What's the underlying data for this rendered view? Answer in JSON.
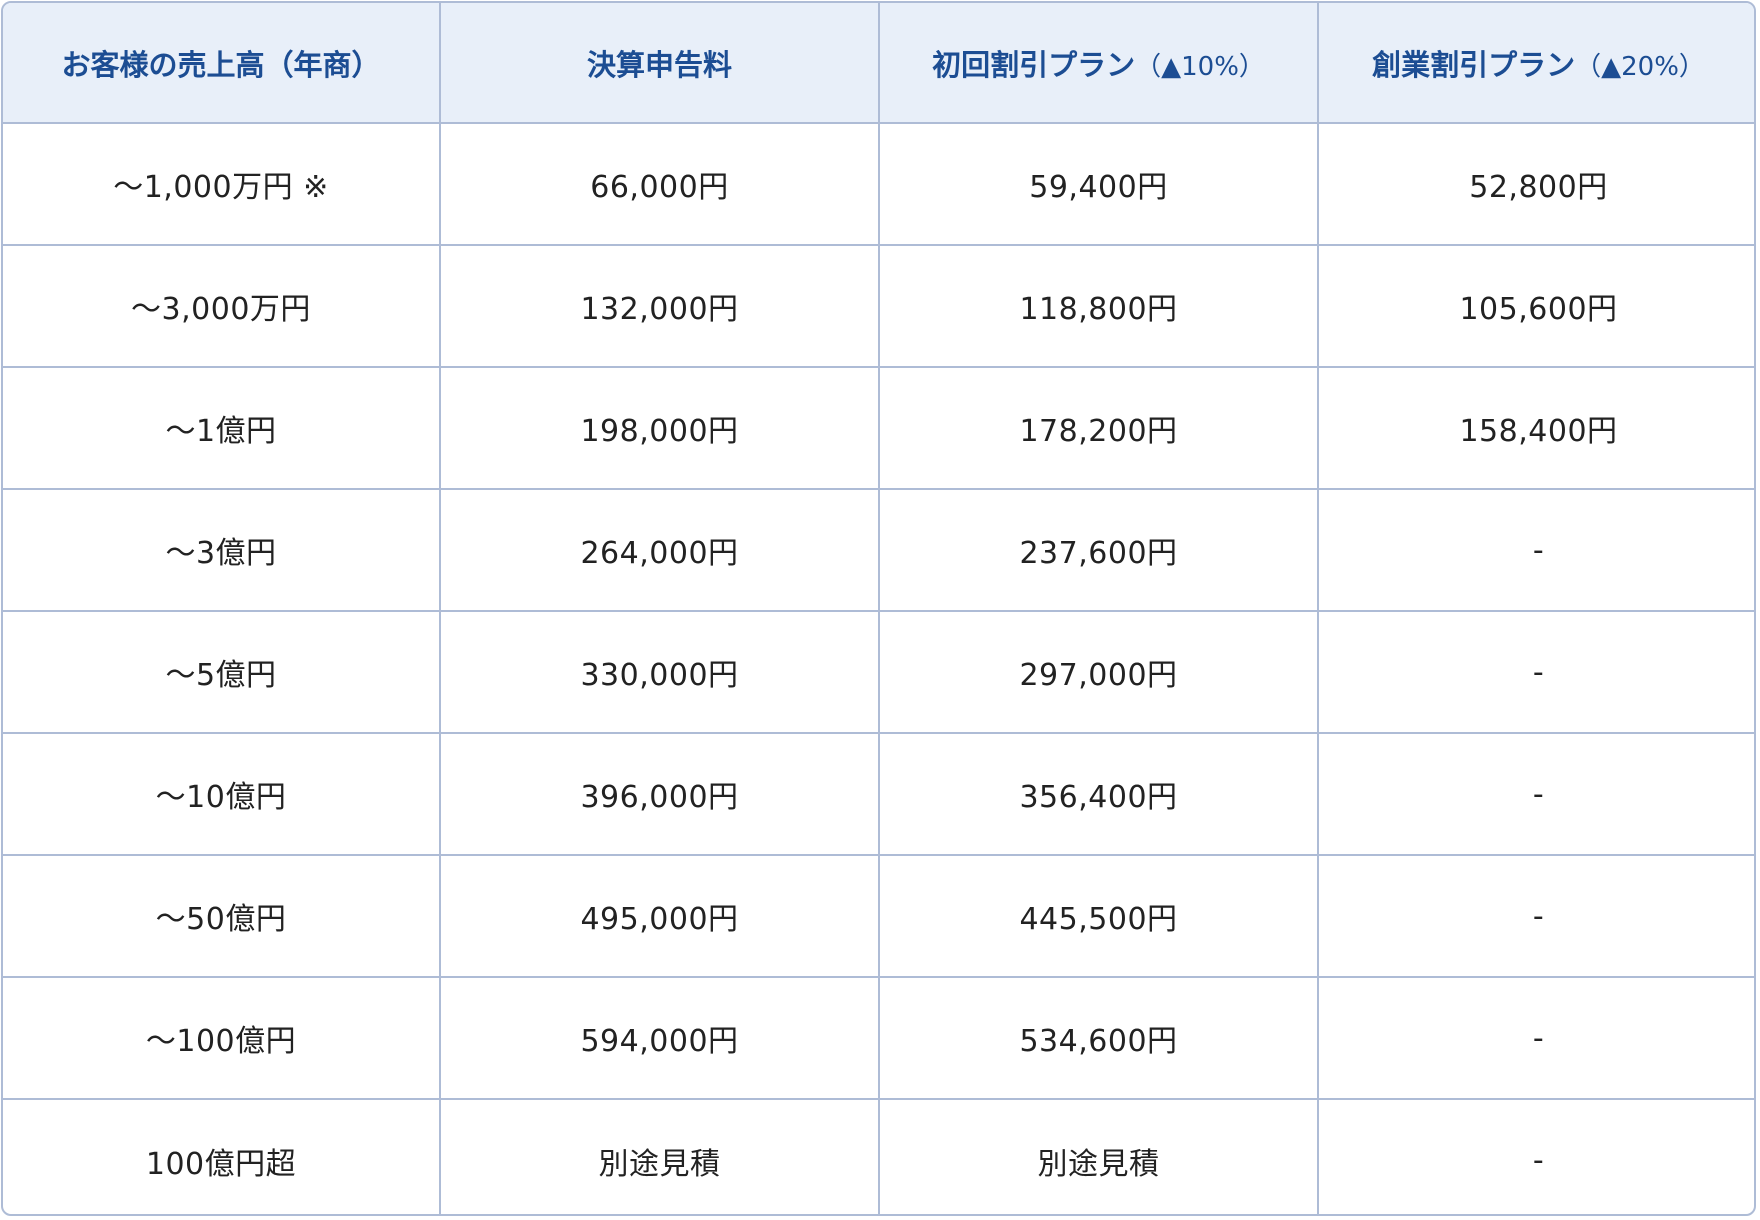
{
  "table": {
    "headers": [
      {
        "label": "お客様の売上高（年商）",
        "suffix": ""
      },
      {
        "label": "決算申告料",
        "suffix": ""
      },
      {
        "label": "初回割引プラン",
        "suffix": "（▲10%）"
      },
      {
        "label": "創業割引プラン",
        "suffix": "（▲20%）"
      }
    ],
    "rows": [
      {
        "revenue": "～1,000万円 ※",
        "fee": "66,000円",
        "first_discount": "59,400円",
        "startup_discount": "52,800円"
      },
      {
        "revenue": "～3,000万円",
        "fee": "132,000円",
        "first_discount": "118,800円",
        "startup_discount": "105,600円"
      },
      {
        "revenue": "～1億円",
        "fee": "198,000円",
        "first_discount": "178,200円",
        "startup_discount": "158,400円"
      },
      {
        "revenue": "～3億円",
        "fee": "264,000円",
        "first_discount": "237,600円",
        "startup_discount": "-"
      },
      {
        "revenue": "～5億円",
        "fee": "330,000円",
        "first_discount": "297,000円",
        "startup_discount": "-"
      },
      {
        "revenue": "～10億円",
        "fee": "396,000円",
        "first_discount": "356,400円",
        "startup_discount": "-"
      },
      {
        "revenue": "～50億円",
        "fee": "495,000円",
        "first_discount": "445,500円",
        "startup_discount": "-"
      },
      {
        "revenue": "～100億円",
        "fee": "594,000円",
        "first_discount": "534,600円",
        "startup_discount": "-"
      },
      {
        "revenue": "100億円超",
        "fee": "別途見積",
        "first_discount": "別途見積",
        "startup_discount": "-"
      }
    ]
  },
  "colors": {
    "header_background": "#e8eff9",
    "header_text": "#1c4d93",
    "border": "#aebcd6",
    "body_text": "#222222"
  }
}
